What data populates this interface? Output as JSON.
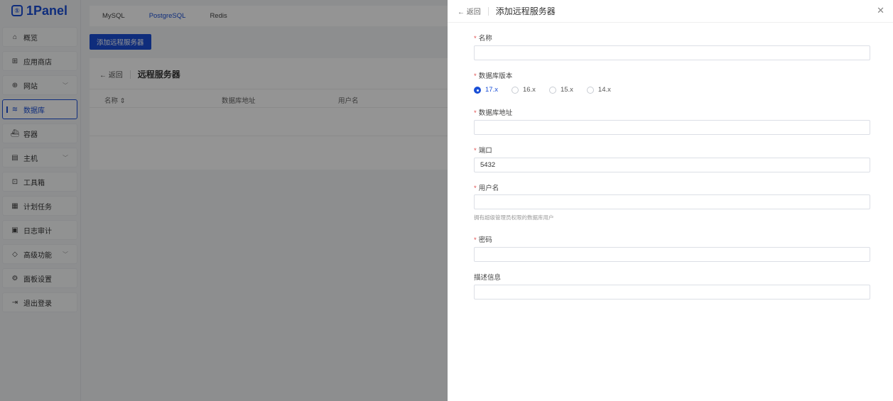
{
  "brand": {
    "name": "1Panel",
    "mark": "①"
  },
  "sidebar": {
    "items": [
      {
        "label": "概览",
        "icon": "⌂"
      },
      {
        "label": "应用商店",
        "icon": "⊞"
      },
      {
        "label": "网站",
        "icon": "⊕",
        "chevron": "﹀"
      },
      {
        "label": "数据库",
        "icon": "≋"
      },
      {
        "label": "容器",
        "icon": "⛴"
      },
      {
        "label": "主机",
        "icon": "▤",
        "chevron": "﹀"
      },
      {
        "label": "工具箱",
        "icon": "⊡"
      },
      {
        "label": "计划任务",
        "icon": "▦"
      },
      {
        "label": "日志审计",
        "icon": "▣"
      },
      {
        "label": "高级功能",
        "icon": "◇",
        "chevron": "﹀"
      },
      {
        "label": "面板设置",
        "icon": "⚙"
      },
      {
        "label": "退出登录",
        "icon": "⇥"
      }
    ]
  },
  "db_tabs": [
    "MySQL",
    "PostgreSQL",
    "Redis"
  ],
  "add_button": "添加远程服务器",
  "list_panel": {
    "back": "← 返回",
    "title": "远程服务器",
    "columns": [
      "名称 ⇕",
      "数据库地址",
      "用户名"
    ]
  },
  "drawer": {
    "back": "← 返回",
    "title": "添加远程服务器",
    "close": "✕",
    "required_mark": "*",
    "fields": {
      "name": {
        "label": "名称",
        "value": ""
      },
      "version": {
        "label": "数据库版本",
        "options": [
          "17.x",
          "16.x",
          "15.x",
          "14.x"
        ],
        "selected": "17.x"
      },
      "address": {
        "label": "数据库地址",
        "value": ""
      },
      "port": {
        "label": "端口",
        "value": "5432"
      },
      "username": {
        "label": "用户名",
        "value": "",
        "hint": "拥有超级管理员权限的数据库用户"
      },
      "password": {
        "label": "密码",
        "value": ""
      },
      "description": {
        "label": "描述信息",
        "value": ""
      }
    }
  },
  "colors": {
    "accent": "#1a4fd6",
    "required": "#e05050"
  }
}
